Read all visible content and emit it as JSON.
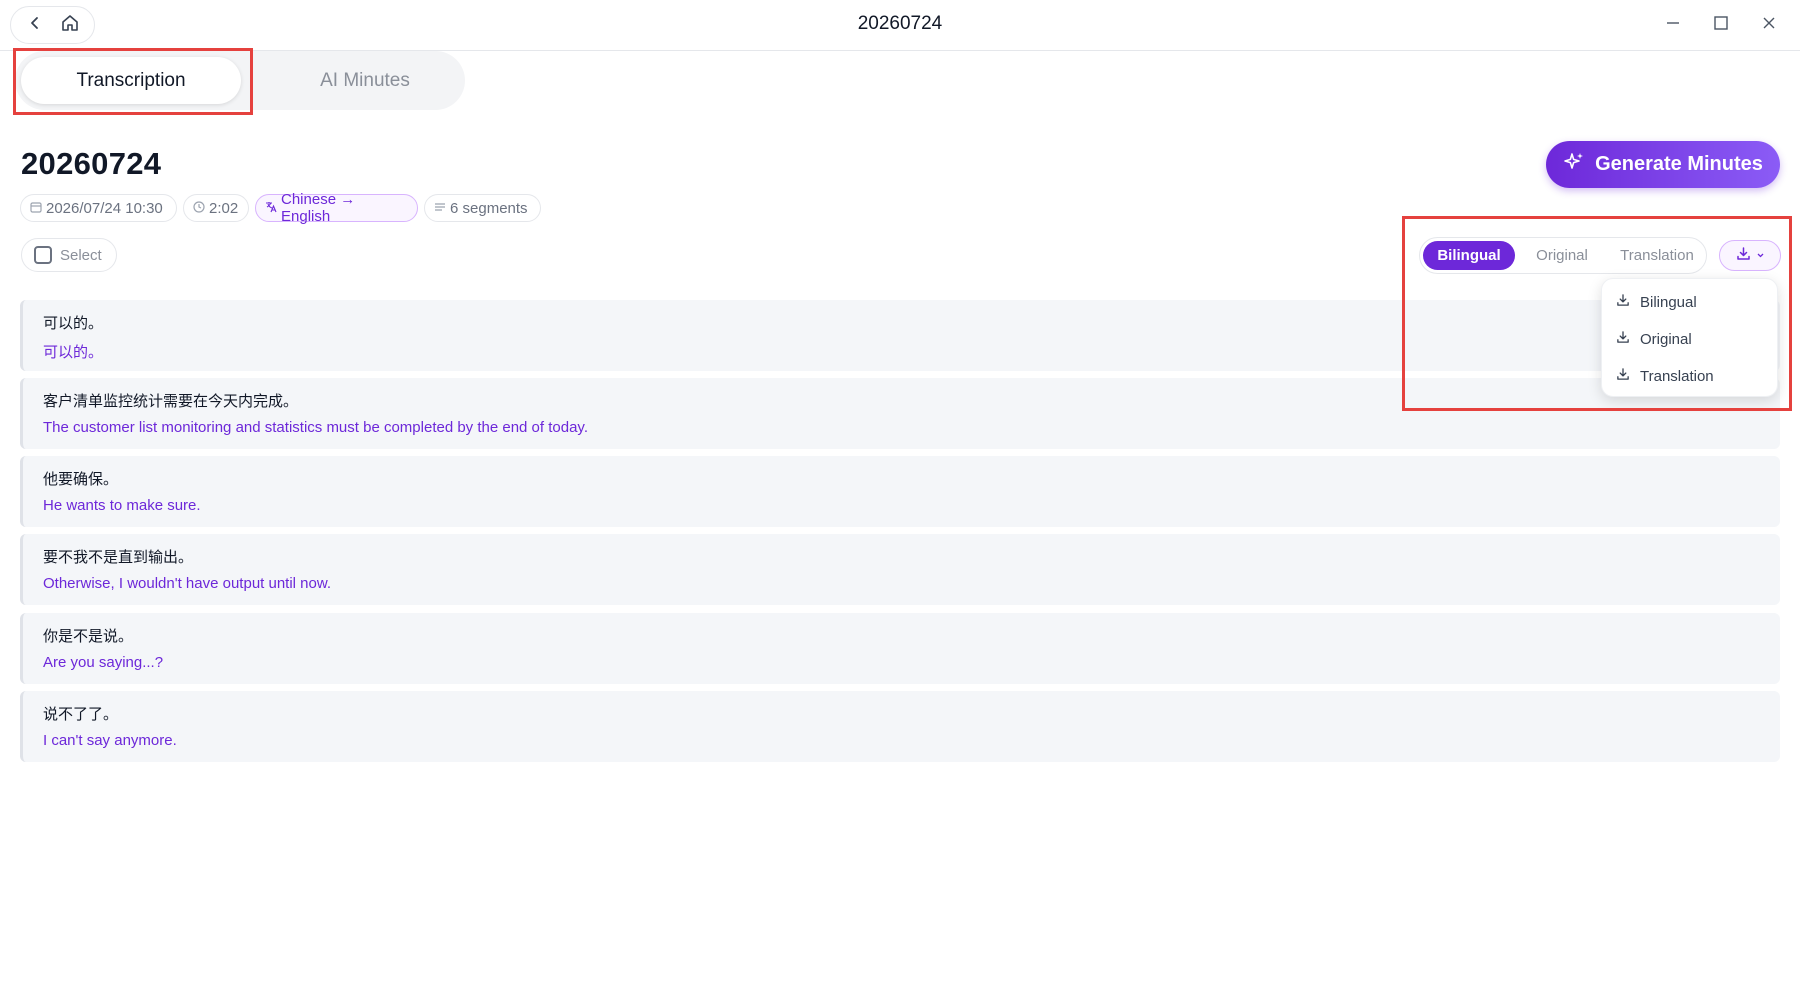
{
  "window": {
    "title": "20260724",
    "back_icon": "chevron-left-icon",
    "home_icon": "home-icon",
    "minimize_icon": "minimize-icon",
    "maximize_icon": "maximize-icon",
    "close_icon": "close-icon"
  },
  "tabs": [
    {
      "label": "Transcription",
      "active": true
    },
    {
      "label": "AI Minutes",
      "active": false
    }
  ],
  "header": {
    "title": "20260724",
    "generate_label": "Generate Minutes",
    "generate_icon": "sparkles-icon",
    "meta": {
      "date": "2026/07/24 10:30",
      "duration": "2:02",
      "languages": "Chinese → English",
      "segments": "6 segments"
    }
  },
  "toolbar": {
    "select_label": "Select",
    "modes": [
      "Bilingual",
      "Original",
      "Translation"
    ],
    "active_mode": "Bilingual",
    "download_icon": "download-icon"
  },
  "download_menu": {
    "items": [
      "Bilingual",
      "Original",
      "Translation"
    ]
  },
  "segments": [
    {
      "original": "可以的。",
      "translation": "可以的。"
    },
    {
      "original": "客户清单监控统计需要在今天内完成。",
      "translation": "The customer list monitoring and statistics must be completed by the end of today."
    },
    {
      "original": "他要确保。",
      "translation": "He wants to make sure."
    },
    {
      "original": "要不我不是直到输出。",
      "translation": "Otherwise, I wouldn't have output until now."
    },
    {
      "original": "你是不是说。",
      "translation": "Are you saying...?"
    },
    {
      "original": "说不了了。",
      "translation": "I can't say anymore."
    }
  ],
  "colors": {
    "accent": "#6d28d9",
    "highlight": "#e5413e"
  }
}
